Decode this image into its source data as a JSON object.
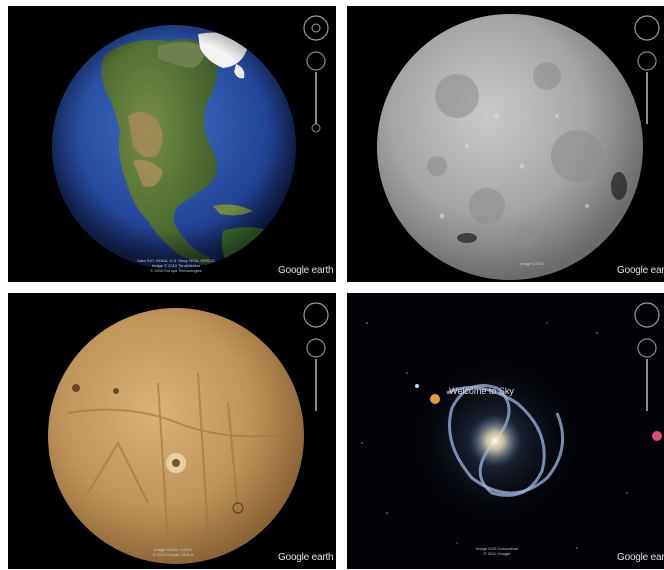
{
  "panels": {
    "earth": {
      "attribution": [
        "Data SIO, NOAA, U.S. Navy, NGA, GEBCO",
        "Image © 2010 TerraMetrics",
        "© 2010 Europa Technologies"
      ],
      "logo": "Google earth"
    },
    "moon": {
      "attribution": [
        "Image USGS"
      ],
      "logo": "Google earth"
    },
    "mars": {
      "attribution": [
        "Image NASA / USGS",
        "© 2010 Google, MOLA"
      ],
      "logo": "Google earth"
    },
    "sky": {
      "welcome": "Welcome to Sky",
      "attribution": [
        "Image DSS Consortium",
        "© 2010 Google"
      ],
      "logo": "Google earth"
    }
  },
  "icons": {
    "navigation": "look-around-ring-icon",
    "zoom": "zoom-slider-icon"
  },
  "colors": {
    "space": "#000000",
    "ocean": "#2d55a8",
    "land": "#5f7f3c",
    "moon": "#a9a9a9",
    "mars": "#c49a5e"
  }
}
